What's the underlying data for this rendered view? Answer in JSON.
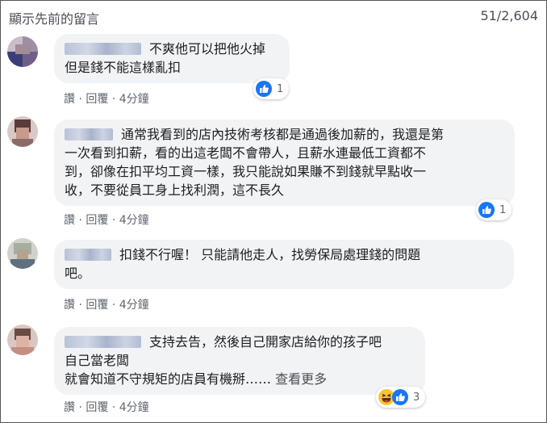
{
  "header": {
    "previous_comments_label": "顯示先前的留言",
    "comment_count": "51/2,604"
  },
  "comments": [
    {
      "lines": [
        "不爽他可以把他火掉",
        "但是錢不能這樣亂扣"
      ],
      "actions": {
        "like": "讚",
        "reply": "回覆",
        "time": "4分鐘"
      },
      "reactions": {
        "icons": [
          "like-icon"
        ],
        "count": "1"
      }
    },
    {
      "lines": [
        "通常我看到的店內技術考核都是通過後加薪的，我還是第",
        "一次看到扣薪，看的出這老闆不會帶人，且薪水連最低工資都不",
        "到，卻像在扣平均工資一樣，我只能說如果賺不到錢就早點收一",
        "收，不要從員工身上找利潤，這不長久"
      ],
      "actions": {
        "like": "讚",
        "reply": "回覆",
        "time": "4分鐘"
      },
      "reactions": {
        "icons": [
          "like-icon"
        ],
        "count": "1"
      }
    },
    {
      "lines": [
        "扣錢不行喔！ 只能請他走人，找勞保局處理錢的問題",
        "吧。"
      ],
      "actions": {
        "like": "讚",
        "reply": "回覆",
        "time": "4分鐘"
      }
    },
    {
      "lines": [
        "支持去告，然後自己開家店給你的孩子吧",
        "自己當老闆",
        "就會知道不守規矩的店員有機掰……"
      ],
      "see_more": "查看更多",
      "actions": {
        "like": "讚",
        "reply": "回覆",
        "time": "4分鐘"
      },
      "reactions": {
        "icons": [
          "haha-icon",
          "like-icon"
        ],
        "count": "3"
      }
    }
  ],
  "colors": {
    "bubble": "#f2f3f5",
    "like_blue": "#1877f2",
    "meta_text": "#606770"
  }
}
